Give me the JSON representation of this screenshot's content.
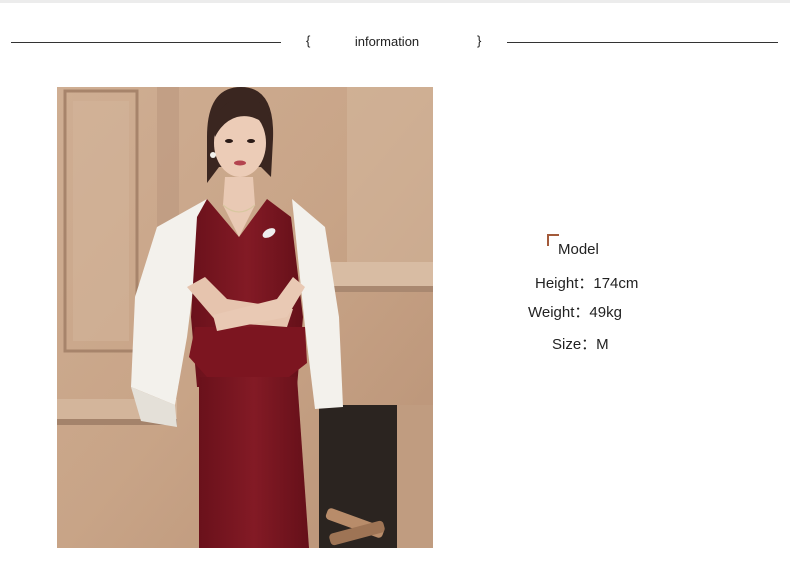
{
  "header": {
    "open_brace": "{",
    "title": "information",
    "close_brace": "}"
  },
  "photo": {
    "subject": "model-photo",
    "colors": {
      "wall": "#c9a68b",
      "dress": "#7a1621",
      "jacket": "#f3f1ec",
      "skin": "#e9c9b4",
      "hair": "#3a2620",
      "fireplace": "#2b2420"
    }
  },
  "model": {
    "label": "Model",
    "accent_color": "#a35a3a",
    "height": "Height：174cm",
    "weight": "Weight：49kg",
    "size": "Size：M"
  }
}
